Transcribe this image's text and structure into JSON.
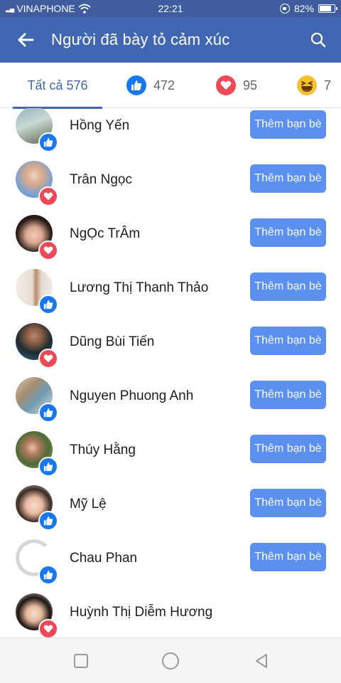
{
  "status_bar": {
    "carrier": "VINAPHONE",
    "time": "22:21",
    "battery_percent": "82%",
    "battery_level": 0.82
  },
  "header": {
    "back_icon": "arrow-left-icon",
    "title": "Người đã bày tỏ cảm xúc",
    "search_icon": "search-icon"
  },
  "tabs": [
    {
      "label": "Tất cả 576",
      "selected": true
    },
    {
      "icon": "like-icon",
      "count": "472"
    },
    {
      "icon": "heart-icon",
      "count": "95"
    },
    {
      "icon": "laugh-emoji-icon",
      "count": "7"
    }
  ],
  "people": [
    {
      "name": "Hồng Yến",
      "reaction": "like",
      "button": "Thêm bạn bè"
    },
    {
      "name": "Trân Ngọc",
      "reaction": "love",
      "button": "Thêm bạn bè"
    },
    {
      "name": "NgỌc TrÂm",
      "reaction": "love",
      "button": "Thêm bạn bè"
    },
    {
      "name": "Lương Thị Thanh Thảo",
      "reaction": "like",
      "button": "Thêm bạn bè"
    },
    {
      "name": "Dũng Bùi Tiến",
      "reaction": "love",
      "button": "Thêm bạn bè"
    },
    {
      "name": "Nguyen Phuong Anh",
      "reaction": "like",
      "button": "Thêm bạn bè"
    },
    {
      "name": "Thúy Hằng",
      "reaction": "like",
      "button": "Thêm bạn bè"
    },
    {
      "name": "Mỹ Lệ",
      "reaction": "like",
      "button": "Thêm bạn bè"
    },
    {
      "name": "Chau Phan",
      "reaction": "like",
      "button": "Thêm bạn bè"
    },
    {
      "name": "Huỳnh Thị Diễm Hương",
      "reaction": "love",
      "button": ""
    }
  ],
  "nav_bar": {
    "recents_icon": "square-icon",
    "home_icon": "circle-icon",
    "back_icon": "triangle-back-icon"
  },
  "colors": {
    "brand": "#4267b2",
    "status_bar": "#3f5d9e",
    "add_friend_button": "#5b8ff0",
    "like": "#1877f2",
    "love": "#ed4956",
    "haha": "#f7c12f"
  }
}
